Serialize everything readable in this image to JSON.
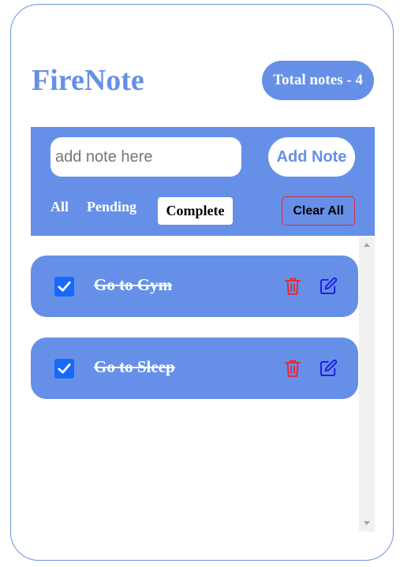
{
  "app": {
    "title": "FireNote"
  },
  "header": {
    "total_label": "Total notes - 4"
  },
  "composer": {
    "placeholder": "add note here",
    "value": "",
    "add_label": "Add Note"
  },
  "filters": {
    "all": "All",
    "pending": "Pending",
    "complete": "Complete",
    "active": "Complete",
    "clear_label": "Clear All"
  },
  "notes": [
    {
      "text": "Go to Gym",
      "completed": true
    },
    {
      "text": "Go to Sleep",
      "completed": true
    }
  ],
  "colors": {
    "accent": "#6690e8",
    "checkbox": "#1769f7",
    "delete": "#e02a3a",
    "edit": "#1a1ae6"
  },
  "icons": {
    "delete": "trash-icon",
    "edit": "edit-icon",
    "check": "checkmark-icon"
  }
}
